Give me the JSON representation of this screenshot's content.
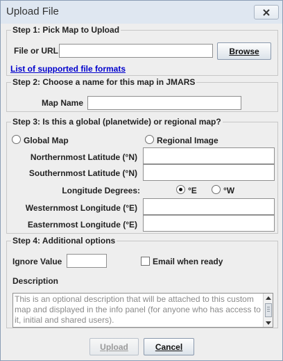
{
  "window": {
    "title": "Upload File"
  },
  "step1": {
    "title": "Step 1: Pick Map to Upload",
    "file_label": "File or URL",
    "file_value": "",
    "browse_label": "Browse",
    "formats_link": "List of supported file formats"
  },
  "step2": {
    "title": "Step 2: Choose a name for this map in JMARS",
    "name_label": "Map Name",
    "name_value": ""
  },
  "step3": {
    "title": "Step 3: Is this a global (planetwide) or regional map?",
    "global_label": "Global Map",
    "regional_label": "Regional Image",
    "north_label": "Northernmost Latitude (°N)",
    "south_label": "Southernmost Latitude (°N)",
    "lon_degrees_label": "Longitude Degrees:",
    "east_label": "°E",
    "west_label": "°W",
    "westmost_label": "Westernmost Longitude (°E)",
    "eastmost_label": "Easternmost Longitude (°E)"
  },
  "step4": {
    "title": "Step 4: Additional options",
    "ignore_label": "Ignore Value",
    "ignore_value": "",
    "email_label": "Email when ready",
    "description_label": "Description",
    "description_placeholder": "This is an optional description that will be attached to this custom map and displayed in the info panel (for anyone who has access to it, initial and shared users)."
  },
  "footer": {
    "upload_label": "Upload",
    "cancel_label": "Cancel"
  },
  "state": {
    "longitude_selected": "E",
    "map_type_selected": "none",
    "email_checked": false,
    "upload_enabled": false
  }
}
